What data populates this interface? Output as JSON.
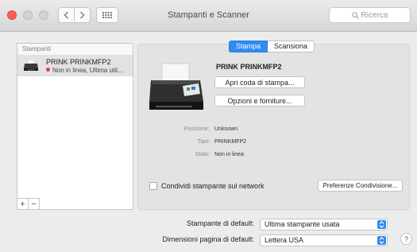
{
  "window": {
    "title": "Stampanti e Scanner",
    "search_placeholder": "Ricerca"
  },
  "sidebar": {
    "header": "Stampanti",
    "printers": [
      {
        "name": "PRINK PRINKMFP2",
        "status": "Non in linea, Ultima util..."
      }
    ],
    "add_label": "+",
    "remove_label": "−"
  },
  "tabs": [
    {
      "label": "Stampa",
      "active": true
    },
    {
      "label": "Scansiona",
      "active": false
    }
  ],
  "printer": {
    "name": "PRINK PRINKMFP2",
    "open_queue_label": "Apri coda di stampa...",
    "options_label": "Opzioni e forniture...",
    "fields": [
      {
        "label": "Posizione:",
        "value": "Unknown"
      },
      {
        "label": "Tipo:",
        "value": "PRINKMFP2"
      },
      {
        "label": "Stato:",
        "value": "Non in linea"
      }
    ],
    "share_label": "Condividi stampante sul network",
    "share_checked": false,
    "sharing_prefs_label": "Preferenze Condivisione..."
  },
  "defaults": {
    "printer_label": "Stampante di default:",
    "printer_value": "Ultima stampante usata",
    "paper_label": "Dimensioni pagina di default:",
    "paper_value": "Lettera USA"
  },
  "help_label": "?",
  "colors": {
    "accent": "#2e8cf2",
    "status_offline": "#e83b3b",
    "close": "#fc5f57"
  }
}
